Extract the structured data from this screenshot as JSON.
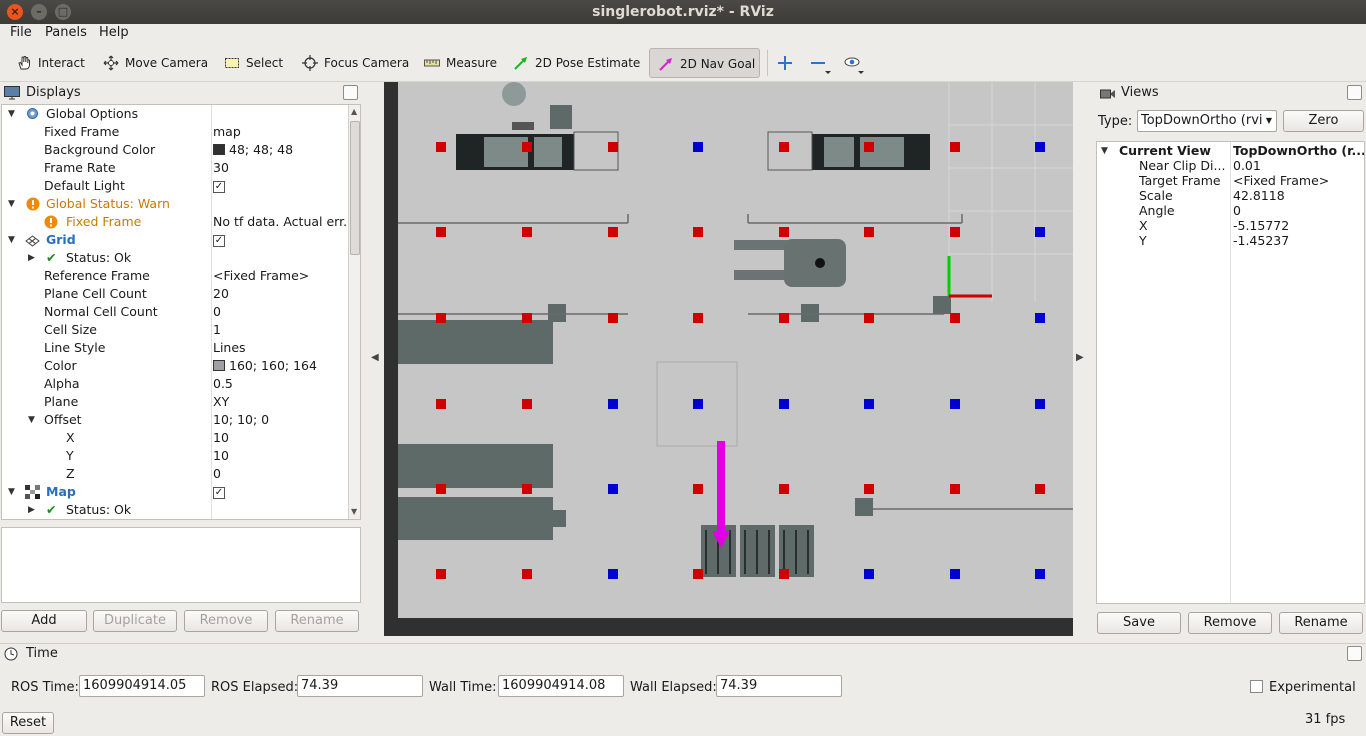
{
  "window": {
    "title": "singlerobot.rviz* - RViz"
  },
  "menubar": {
    "items": [
      "File",
      "Panels",
      "Help"
    ]
  },
  "toolbar": {
    "tools": [
      "Interact",
      "Move Camera",
      "Select",
      "Focus Camera",
      "Measure",
      "2D Pose Estimate",
      "2D Nav Goal"
    ],
    "active_tool": "2D Nav Goal",
    "icons": [
      "hand-icon",
      "move-camera-icon",
      "select-icon",
      "focus-camera-icon",
      "measure-icon",
      "pose-estimate-arrow-icon",
      "nav-goal-arrow-icon",
      "plus-icon",
      "minus-icon",
      "eye-icon"
    ]
  },
  "displays": {
    "title": "Displays",
    "rows": [
      {
        "label": "Global Options",
        "value": ""
      },
      {
        "label": "Fixed Frame",
        "value": "map"
      },
      {
        "label": "Background Color",
        "value": "48; 48; 48"
      },
      {
        "label": "Frame Rate",
        "value": "30"
      },
      {
        "label": "Default Light",
        "value": ""
      },
      {
        "label": "Global Status: Warn",
        "value": ""
      },
      {
        "label": "Fixed Frame",
        "value": "No tf data.  Actual err."
      },
      {
        "label": "Grid",
        "value": ""
      },
      {
        "label": "Status: Ok",
        "value": ""
      },
      {
        "label": "Reference Frame",
        "value": "<Fixed Frame>"
      },
      {
        "label": "Plane Cell Count",
        "value": "20"
      },
      {
        "label": "Normal Cell Count",
        "value": "0"
      },
      {
        "label": "Cell Size",
        "value": "1"
      },
      {
        "label": "Line Style",
        "value": "Lines"
      },
      {
        "label": "Color",
        "value": "160; 160; 164"
      },
      {
        "label": "Alpha",
        "value": "0.5"
      },
      {
        "label": "Plane",
        "value": "XY"
      },
      {
        "label": "Offset",
        "value": "10; 10; 0"
      },
      {
        "label": "X",
        "value": "10"
      },
      {
        "label": "Y",
        "value": "10"
      },
      {
        "label": "Z",
        "value": "0"
      },
      {
        "label": "Map",
        "value": ""
      },
      {
        "label": "Status: Ok",
        "value": ""
      }
    ],
    "checks": {
      "default_light": "✓",
      "grid": "✓",
      "map": "✓"
    },
    "colors": {
      "background": "#303030",
      "grid": "#a0a0a4",
      "warn": "#c87a00",
      "blue_label": "#2a6ebb"
    },
    "buttons": {
      "add": "Add",
      "duplicate": "Duplicate",
      "remove": "Remove",
      "rename": "Rename"
    }
  },
  "views": {
    "title": "Views",
    "type_label": "Type:",
    "type_value": "TopDownOrtho (rvi",
    "zero_label": "Zero",
    "current_view": {
      "label": "Current View",
      "value": "TopDownOrtho (r..."
    },
    "props": [
      {
        "label": "Near Clip Di...",
        "value": "0.01"
      },
      {
        "label": "Target Frame",
        "value": "<Fixed Frame>"
      },
      {
        "label": "Scale",
        "value": "42.8118"
      },
      {
        "label": "Angle",
        "value": "0"
      },
      {
        "label": "X",
        "value": "-5.15772"
      },
      {
        "label": "Y",
        "value": "-1.45237"
      }
    ],
    "buttons": {
      "save": "Save",
      "remove": "Remove",
      "rename": "Rename"
    }
  },
  "time": {
    "title": "Time",
    "ros_time_label": "ROS Time:",
    "ros_time": "1609904914.05",
    "ros_elapsed_label": "ROS Elapsed:",
    "ros_elapsed": "74.39",
    "wall_time_label": "Wall Time:",
    "wall_time": "1609904914.08",
    "wall_elapsed_label": "Wall Elapsed:",
    "wall_elapsed": "74.39",
    "experimental_label": "Experimental",
    "reset_label": "Reset",
    "fps": "31 fps"
  }
}
